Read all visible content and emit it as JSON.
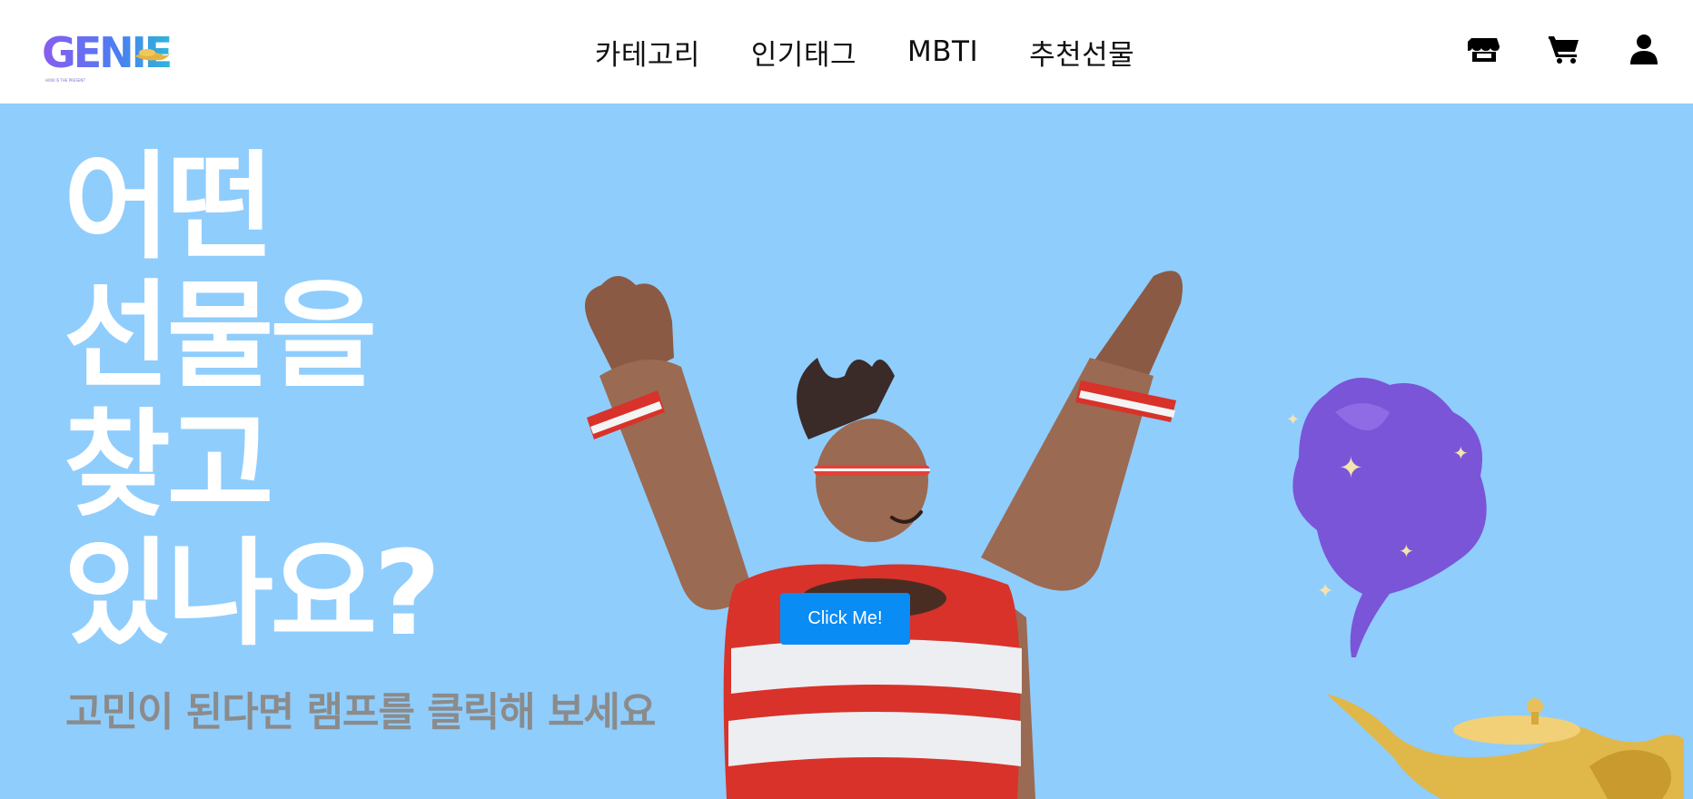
{
  "brand": {
    "logo_text": "GENIE",
    "logo_tagline": "HOW IS THE PRESENT"
  },
  "nav": {
    "items": [
      {
        "label": "카테고리"
      },
      {
        "label": "인기태그"
      },
      {
        "label": "MBTI"
      },
      {
        "label": "추천선물"
      }
    ]
  },
  "header_icons": [
    "store-icon",
    "cart-icon",
    "user-icon"
  ],
  "hero": {
    "headline_lines": [
      "어떤",
      "선물을",
      "찾고",
      "있나요?"
    ],
    "subtitle": "고민이 된다면 램프를 클릭해 보세요",
    "button_label": "Click Me!",
    "background_color": "#8fcdfd",
    "button_color": "#0a8cf5"
  }
}
